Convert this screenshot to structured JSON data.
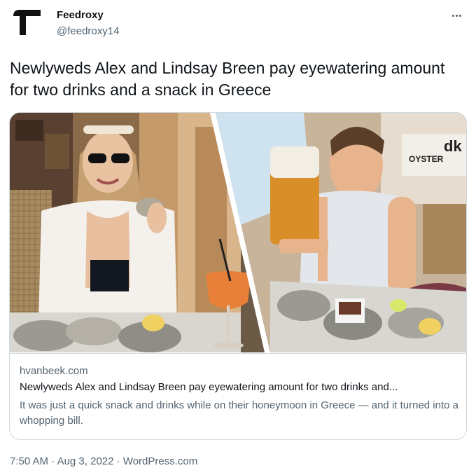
{
  "author": {
    "name": "Feedroxy",
    "handle": "@feedroxy14",
    "avatar_icon": "feedroxy-logo-icon"
  },
  "more_icon": "more-horizontal-icon",
  "tweet": {
    "text": "Newlyweds Alex and Lindsay Breen pay eyewatering amount for two drinks and a snack in Greece"
  },
  "card": {
    "domain": "hvanbeek.com",
    "title": "Newlyweds Alex and Lindsay Breen pay eyewatering amount for two drinks and...",
    "description": "It was just a quick snack and drinks while on their honeymoon in Greece — and it turned into a whopping bill.",
    "image_sign_text": "OYSTER",
    "image_sign_logo": "dk"
  },
  "meta": {
    "time": "7:50 AM",
    "date": "Aug 3, 2022",
    "source": "WordPress.com",
    "separator": "·"
  },
  "colors": {
    "text_primary": "#0f1419",
    "text_secondary": "#536471",
    "border": "#cfd9de"
  }
}
